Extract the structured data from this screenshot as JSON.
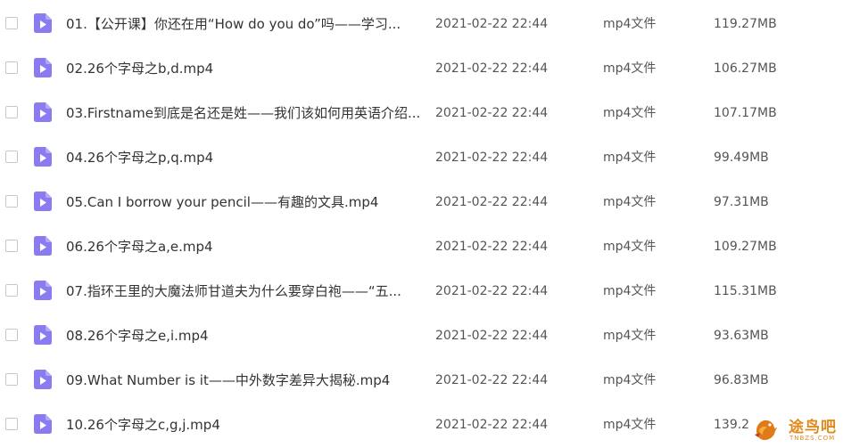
{
  "files": [
    {
      "name": "01.【公开课】你还在用“How do you do”吗——学习...",
      "date": "2021-02-22 22:44",
      "type": "mp4文件",
      "size": "119.27MB"
    },
    {
      "name": "02.26个字母之b,d.mp4",
      "date": "2021-02-22 22:44",
      "type": "mp4文件",
      "size": "106.27MB"
    },
    {
      "name": "03.Firstname到底是名还是姓——我们该如何用英语介绍...",
      "date": "2021-02-22 22:44",
      "type": "mp4文件",
      "size": "107.17MB"
    },
    {
      "name": "04.26个字母之p,q.mp4",
      "date": "2021-02-22 22:44",
      "type": "mp4文件",
      "size": "99.49MB"
    },
    {
      "name": "05.Can I borrow your pencil——有趣的文具.mp4",
      "date": "2021-02-22 22:44",
      "type": "mp4文件",
      "size": "97.31MB"
    },
    {
      "name": "06.26个字母之a,e.mp4",
      "date": "2021-02-22 22:44",
      "type": "mp4文件",
      "size": "109.27MB"
    },
    {
      "name": "07.指环王里的大魔法师甘道夫为什么要穿白袍——“五...",
      "date": "2021-02-22 22:44",
      "type": "mp4文件",
      "size": "115.31MB"
    },
    {
      "name": "08.26个字母之e,i.mp4",
      "date": "2021-02-22 22:44",
      "type": "mp4文件",
      "size": "93.63MB"
    },
    {
      "name": "09.What Number is it——中外数字差异大揭秘.mp4",
      "date": "2021-02-22 22:44",
      "type": "mp4文件",
      "size": "96.83MB"
    },
    {
      "name": "10.26个字母之c,g,j.mp4",
      "date": "2021-02-22 22:44",
      "type": "mp4文件",
      "size": "139.2"
    }
  ],
  "watermark": {
    "text": "途鸟吧",
    "subtext": "TNBZS.COM"
  },
  "colors": {
    "file_icon": "#8a7cf0",
    "checkbox_border": "#c8c8c8",
    "watermark": "#e08a1e"
  }
}
